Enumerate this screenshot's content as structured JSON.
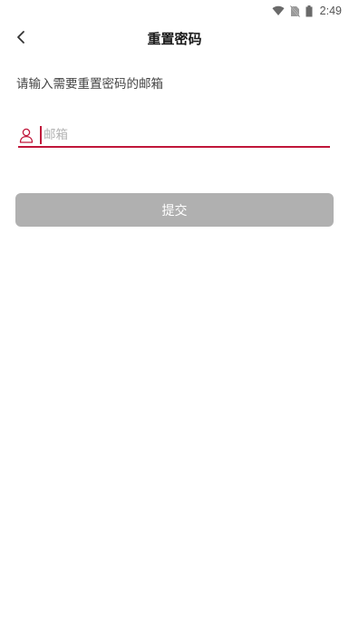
{
  "status_bar": {
    "time": "2:49",
    "icons": [
      "wifi-icon",
      "no-sim-icon",
      "battery-icon"
    ]
  },
  "header": {
    "back_icon": "chevron-left-icon",
    "title": "重置密码"
  },
  "form": {
    "instruction": "请输入需要重置密码的邮箱",
    "email": {
      "icon": "user-icon",
      "value": "",
      "placeholder": "邮箱"
    },
    "submit_label": "提交"
  },
  "colors": {
    "accent": "#c0163a",
    "button_disabled_bg": "#b0b0b0",
    "button_text": "#ffffff",
    "placeholder": "#b3b3b3"
  }
}
